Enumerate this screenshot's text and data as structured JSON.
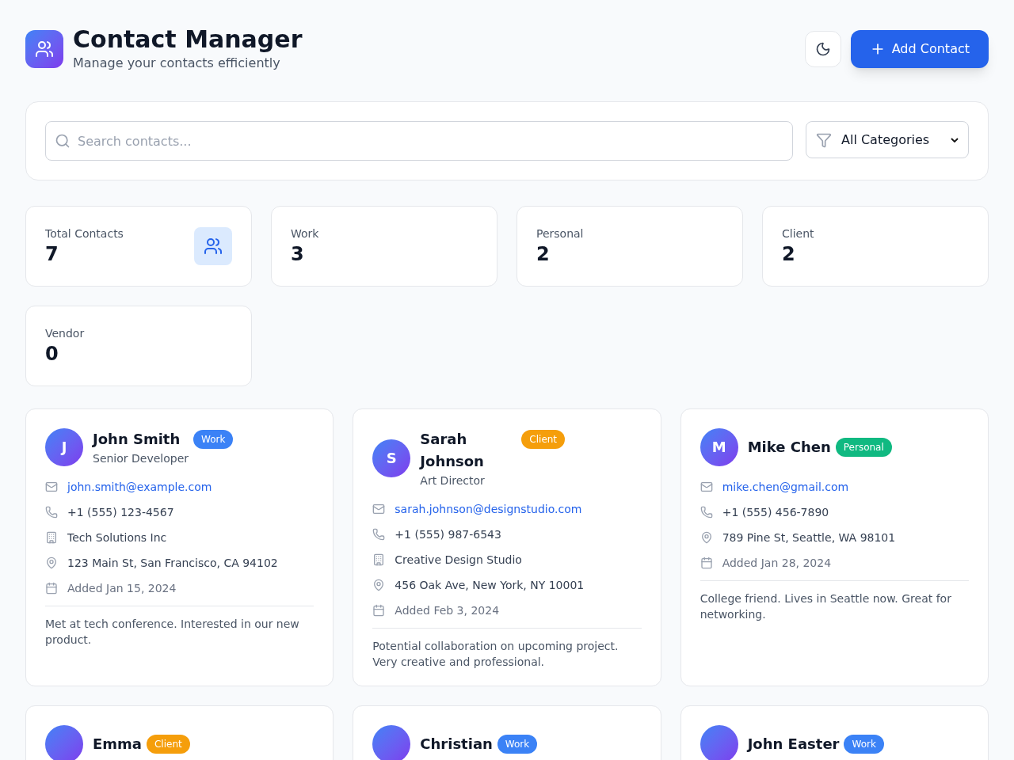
{
  "header": {
    "title": "Contact Manager",
    "subtitle": "Manage your contacts efficiently",
    "add_button": "Add Contact"
  },
  "search": {
    "placeholder": "Search contacts...",
    "category_filter": "All Categories"
  },
  "stats": [
    {
      "label": "Total Contacts",
      "value": "7",
      "kind": "total"
    },
    {
      "label": "Work",
      "value": "3",
      "kind": "plain"
    },
    {
      "label": "Personal",
      "value": "2",
      "kind": "plain"
    },
    {
      "label": "Client",
      "value": "2",
      "kind": "plain"
    },
    {
      "label": "Vendor",
      "value": "0",
      "kind": "plain"
    }
  ],
  "contacts": [
    {
      "initial": "J",
      "name": "John Smith",
      "category": "Work",
      "color": "#3b82f6",
      "role": "Senior Developer",
      "email": "john.smith@example.com",
      "phone": "+1 (555) 123-4567",
      "company": "Tech Solutions Inc",
      "address": "123 Main St, San Francisco, CA 94102",
      "added": "Added Jan 15, 2024",
      "notes": "Met at tech conference. Interested in our new product."
    },
    {
      "initial": "S",
      "name": "Sarah Johnson",
      "category": "Client",
      "color": "#f59e0b",
      "role": "Art Director",
      "email": "sarah.johnson@designstudio.com",
      "phone": "+1 (555) 987-6543",
      "company": "Creative Design Studio",
      "address": "456 Oak Ave, New York, NY 10001",
      "added": "Added Feb 3, 2024",
      "notes": "Potential collaboration on upcoming project. Very creative and professional."
    },
    {
      "initial": "M",
      "name": "Mike Chen",
      "category": "Personal",
      "color": "#10b981",
      "email": "mike.chen@gmail.com",
      "phone": "+1 (555) 456-7890",
      "address": "789 Pine St, Seattle, WA 98101",
      "added": "Added Jan 28, 2024",
      "notes": "College friend. Lives in Seattle now. Great for networking."
    },
    {
      "name": "Emma",
      "category": "Client",
      "color": "#f59e0b"
    },
    {
      "name": "Christian",
      "category": "Work",
      "color": "#3b82f6"
    },
    {
      "name": "John Easter",
      "category": "Work",
      "color": "#3b82f6"
    }
  ]
}
